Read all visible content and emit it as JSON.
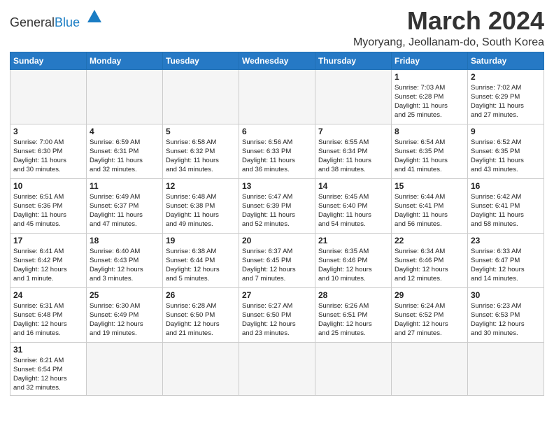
{
  "header": {
    "logo_general": "General",
    "logo_blue": "Blue",
    "month_title": "March 2024",
    "location": "Myoryang, Jeollanam-do, South Korea"
  },
  "weekdays": [
    "Sunday",
    "Monday",
    "Tuesday",
    "Wednesday",
    "Thursday",
    "Friday",
    "Saturday"
  ],
  "weeks": [
    [
      {
        "day": "",
        "info": ""
      },
      {
        "day": "",
        "info": ""
      },
      {
        "day": "",
        "info": ""
      },
      {
        "day": "",
        "info": ""
      },
      {
        "day": "",
        "info": ""
      },
      {
        "day": "1",
        "info": "Sunrise: 7:03 AM\nSunset: 6:28 PM\nDaylight: 11 hours\nand 25 minutes."
      },
      {
        "day": "2",
        "info": "Sunrise: 7:02 AM\nSunset: 6:29 PM\nDaylight: 11 hours\nand 27 minutes."
      }
    ],
    [
      {
        "day": "3",
        "info": "Sunrise: 7:00 AM\nSunset: 6:30 PM\nDaylight: 11 hours\nand 30 minutes."
      },
      {
        "day": "4",
        "info": "Sunrise: 6:59 AM\nSunset: 6:31 PM\nDaylight: 11 hours\nand 32 minutes."
      },
      {
        "day": "5",
        "info": "Sunrise: 6:58 AM\nSunset: 6:32 PM\nDaylight: 11 hours\nand 34 minutes."
      },
      {
        "day": "6",
        "info": "Sunrise: 6:56 AM\nSunset: 6:33 PM\nDaylight: 11 hours\nand 36 minutes."
      },
      {
        "day": "7",
        "info": "Sunrise: 6:55 AM\nSunset: 6:34 PM\nDaylight: 11 hours\nand 38 minutes."
      },
      {
        "day": "8",
        "info": "Sunrise: 6:54 AM\nSunset: 6:35 PM\nDaylight: 11 hours\nand 41 minutes."
      },
      {
        "day": "9",
        "info": "Sunrise: 6:52 AM\nSunset: 6:35 PM\nDaylight: 11 hours\nand 43 minutes."
      }
    ],
    [
      {
        "day": "10",
        "info": "Sunrise: 6:51 AM\nSunset: 6:36 PM\nDaylight: 11 hours\nand 45 minutes."
      },
      {
        "day": "11",
        "info": "Sunrise: 6:49 AM\nSunset: 6:37 PM\nDaylight: 11 hours\nand 47 minutes."
      },
      {
        "day": "12",
        "info": "Sunrise: 6:48 AM\nSunset: 6:38 PM\nDaylight: 11 hours\nand 49 minutes."
      },
      {
        "day": "13",
        "info": "Sunrise: 6:47 AM\nSunset: 6:39 PM\nDaylight: 11 hours\nand 52 minutes."
      },
      {
        "day": "14",
        "info": "Sunrise: 6:45 AM\nSunset: 6:40 PM\nDaylight: 11 hours\nand 54 minutes."
      },
      {
        "day": "15",
        "info": "Sunrise: 6:44 AM\nSunset: 6:41 PM\nDaylight: 11 hours\nand 56 minutes."
      },
      {
        "day": "16",
        "info": "Sunrise: 6:42 AM\nSunset: 6:41 PM\nDaylight: 11 hours\nand 58 minutes."
      }
    ],
    [
      {
        "day": "17",
        "info": "Sunrise: 6:41 AM\nSunset: 6:42 PM\nDaylight: 12 hours\nand 1 minute."
      },
      {
        "day": "18",
        "info": "Sunrise: 6:40 AM\nSunset: 6:43 PM\nDaylight: 12 hours\nand 3 minutes."
      },
      {
        "day": "19",
        "info": "Sunrise: 6:38 AM\nSunset: 6:44 PM\nDaylight: 12 hours\nand 5 minutes."
      },
      {
        "day": "20",
        "info": "Sunrise: 6:37 AM\nSunset: 6:45 PM\nDaylight: 12 hours\nand 7 minutes."
      },
      {
        "day": "21",
        "info": "Sunrise: 6:35 AM\nSunset: 6:46 PM\nDaylight: 12 hours\nand 10 minutes."
      },
      {
        "day": "22",
        "info": "Sunrise: 6:34 AM\nSunset: 6:46 PM\nDaylight: 12 hours\nand 12 minutes."
      },
      {
        "day": "23",
        "info": "Sunrise: 6:33 AM\nSunset: 6:47 PM\nDaylight: 12 hours\nand 14 minutes."
      }
    ],
    [
      {
        "day": "24",
        "info": "Sunrise: 6:31 AM\nSunset: 6:48 PM\nDaylight: 12 hours\nand 16 minutes."
      },
      {
        "day": "25",
        "info": "Sunrise: 6:30 AM\nSunset: 6:49 PM\nDaylight: 12 hours\nand 19 minutes."
      },
      {
        "day": "26",
        "info": "Sunrise: 6:28 AM\nSunset: 6:50 PM\nDaylight: 12 hours\nand 21 minutes."
      },
      {
        "day": "27",
        "info": "Sunrise: 6:27 AM\nSunset: 6:50 PM\nDaylight: 12 hours\nand 23 minutes."
      },
      {
        "day": "28",
        "info": "Sunrise: 6:26 AM\nSunset: 6:51 PM\nDaylight: 12 hours\nand 25 minutes."
      },
      {
        "day": "29",
        "info": "Sunrise: 6:24 AM\nSunset: 6:52 PM\nDaylight: 12 hours\nand 27 minutes."
      },
      {
        "day": "30",
        "info": "Sunrise: 6:23 AM\nSunset: 6:53 PM\nDaylight: 12 hours\nand 30 minutes."
      }
    ],
    [
      {
        "day": "31",
        "info": "Sunrise: 6:21 AM\nSunset: 6:54 PM\nDaylight: 12 hours\nand 32 minutes."
      },
      {
        "day": "",
        "info": ""
      },
      {
        "day": "",
        "info": ""
      },
      {
        "day": "",
        "info": ""
      },
      {
        "day": "",
        "info": ""
      },
      {
        "day": "",
        "info": ""
      },
      {
        "day": "",
        "info": ""
      }
    ]
  ]
}
